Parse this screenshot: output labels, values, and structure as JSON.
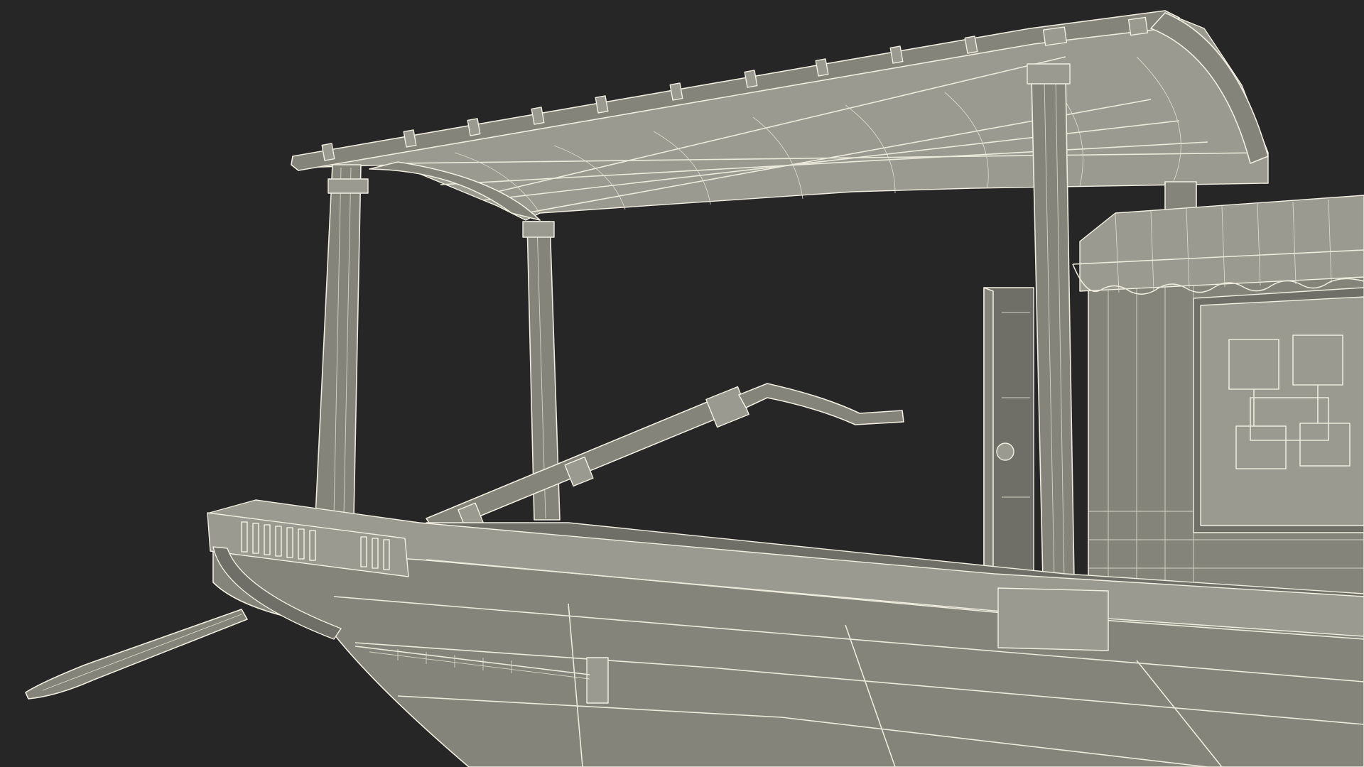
{
  "scene": {
    "subject": "wireframe-boat-model",
    "background_color": "#262626",
    "mesh_fill_color": "#84847a",
    "wire_color": "#eceadb"
  }
}
